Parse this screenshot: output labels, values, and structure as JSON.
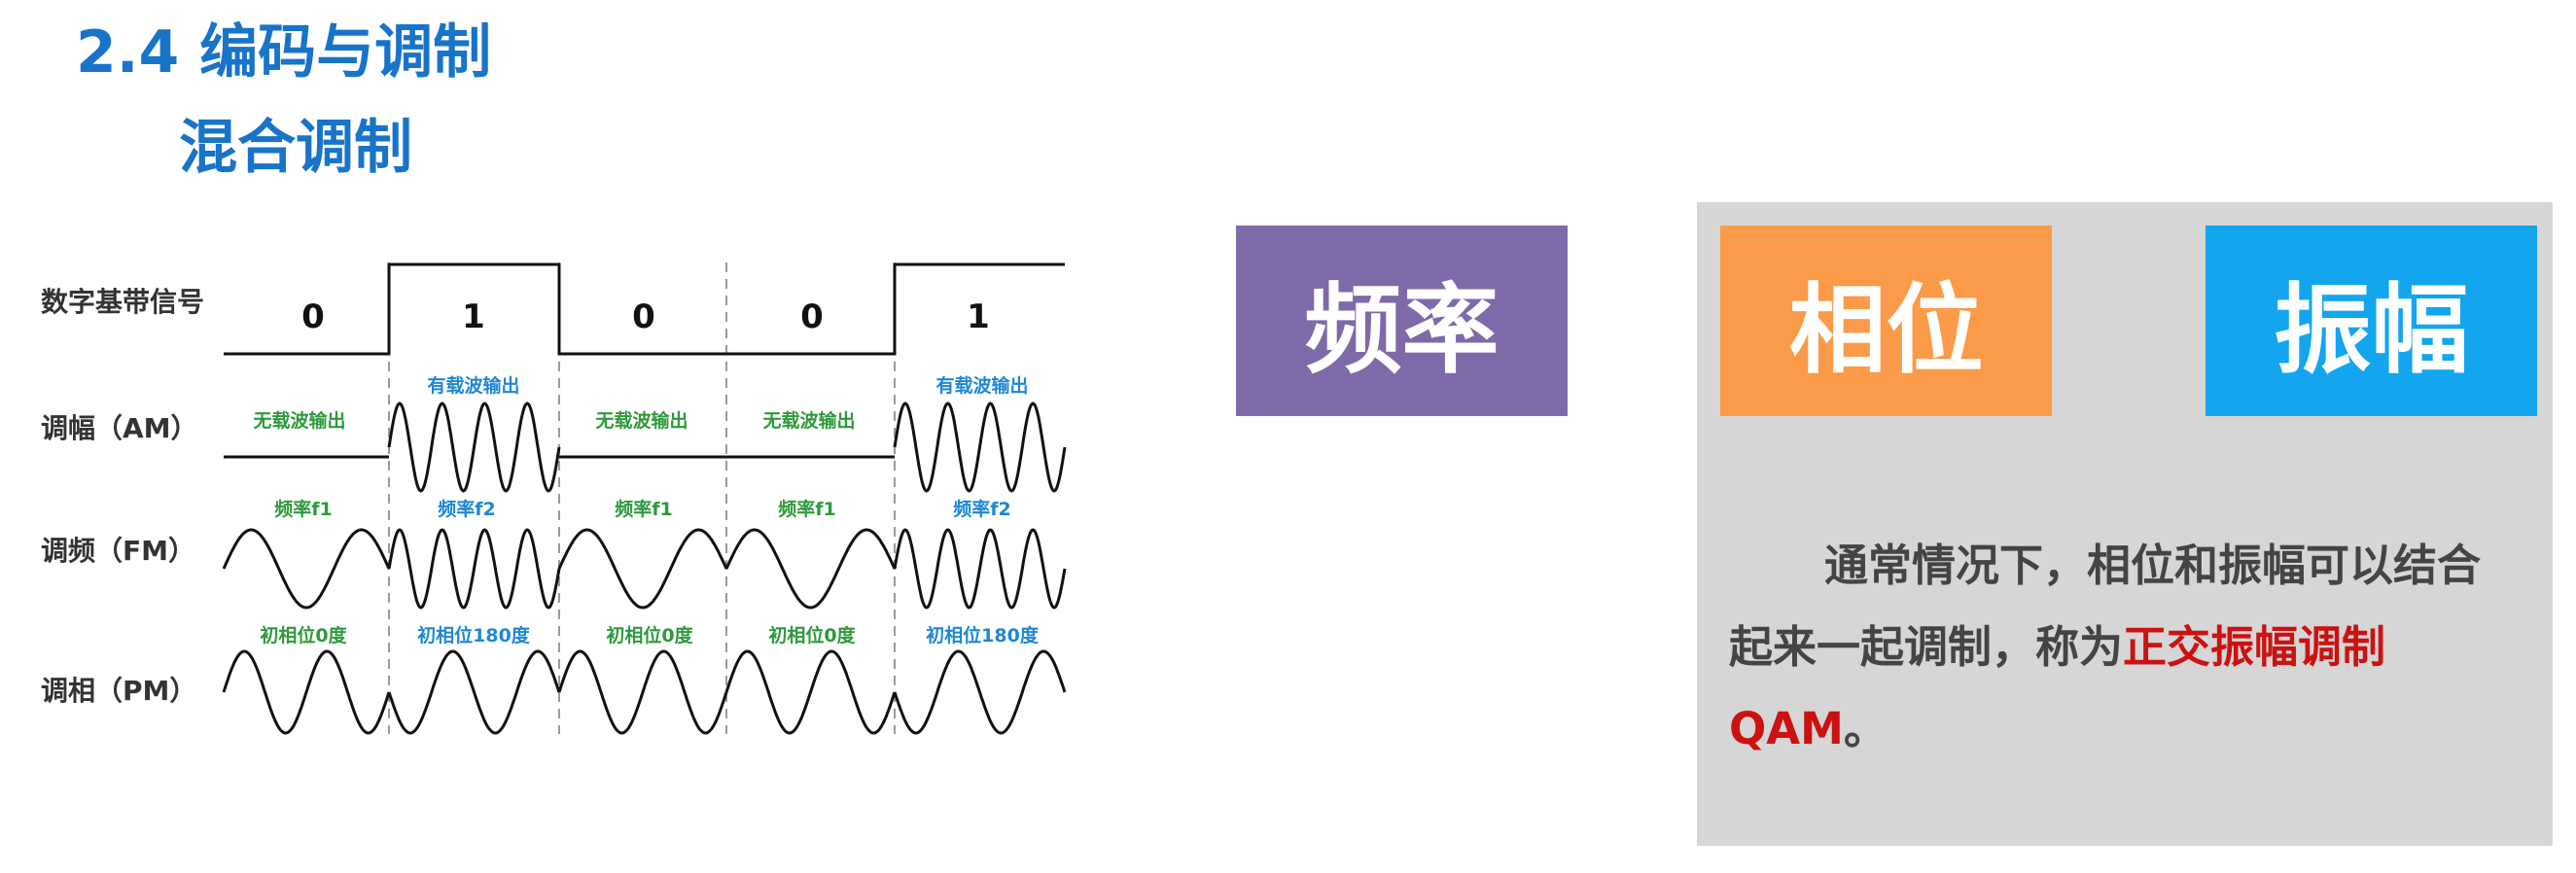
{
  "header": {
    "title": "2.4 编码与调制",
    "subtitle": "混合调制"
  },
  "diagram": {
    "row_labels": {
      "digital": "数字基带信号",
      "am": "调幅（AM）",
      "fm": "调频（FM）",
      "pm": "调相（PM）"
    },
    "bits": [
      "0",
      "1",
      "0",
      "0",
      "1"
    ],
    "am_labels": [
      "无载波输出",
      "有载波输出",
      "无载波输出",
      "无载波输出",
      "有载波输出"
    ],
    "fm_labels": [
      "频率f1",
      "频率f2",
      "频率f1",
      "频率f1",
      "频率f2"
    ],
    "pm_labels": [
      "初相位0度",
      "初相位180度",
      "初相位0度",
      "初相位0度",
      "初相位180度"
    ],
    "colors": {
      "green_label": "#2e9a3c",
      "blue_label": "#1e88d4",
      "line": "#111111",
      "dashed": "#9a9a9a"
    }
  },
  "boxes": {
    "frequency": {
      "label": "频率",
      "color": "#7e69a9"
    },
    "phase": {
      "label": "相位",
      "color": "#fb9a48"
    },
    "amplitude": {
      "label": "振幅",
      "color": "#13a6ef"
    }
  },
  "description": {
    "part1": "通常情况下，相位和振幅可以结合起来一起调制，称为",
    "highlight": "正交振幅调制QAM",
    "part2": "。"
  }
}
